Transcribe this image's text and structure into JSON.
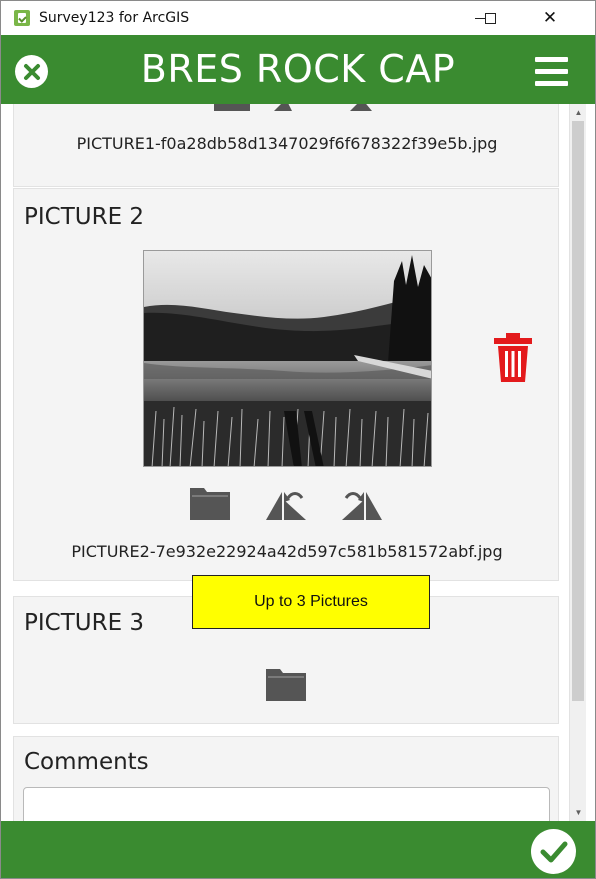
{
  "window": {
    "title": "Survey123 for ArcGIS",
    "minimize": "—",
    "maximize": "☐",
    "close": "✕"
  },
  "header": {
    "title": "BRES ROCK CAP",
    "close_icon": "close-circle-icon",
    "menu_icon": "hamburger-menu-icon"
  },
  "questions": {
    "picture1": {
      "filename": "PICTURE1-f0a28db58d1347029f6f678322f39e5b.jpg"
    },
    "picture2": {
      "title": "PICTURE 2",
      "filename": "PICTURE2-7e932e22924a42d597c581b581572abf.jpg",
      "actions": [
        "folder-icon",
        "rotate-left-icon",
        "rotate-right-icon"
      ],
      "delete_icon": "trash-icon"
    },
    "picture3": {
      "title": "PICTURE 3",
      "actions": [
        "folder-icon"
      ]
    },
    "comments": {
      "title": "Comments",
      "value": ""
    }
  },
  "tooltip": {
    "text": "Up to 3 Pictures"
  },
  "footer": {
    "submit_icon": "check-circle-icon"
  },
  "colors": {
    "brand_green": "#3a8b30",
    "delete_red": "#e31a1c",
    "tooltip_yellow": "#ffff00",
    "icon_gray": "#555555"
  }
}
